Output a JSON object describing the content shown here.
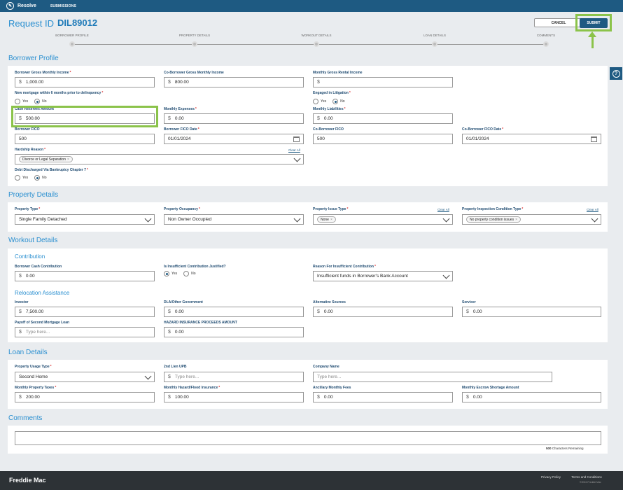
{
  "app": {
    "name": "Resolve",
    "nav_item": "SUBMISSIONS"
  },
  "header": {
    "request_label": "Request ID",
    "request_id": "DIL89012",
    "cancel_label": "CANCEL",
    "submit_label": "SUBMIT"
  },
  "stepper": [
    "BORROWER PROFILE",
    "PROPERTY DETAILS",
    "WORKOUT DETAILS",
    "LOAN DETAILS",
    "COMMENTS"
  ],
  "currency_symbol": "$",
  "required_mark": "*",
  "clear_all": "Clear All",
  "chip_remove": "×",
  "radio": {
    "yes": "Yes",
    "no": "No"
  },
  "borrower": {
    "title": "Borrower Profile",
    "gross_income_label": "Borrower Gross Monthly Income",
    "gross_income": "1,000.00",
    "co_gross_income_label": "Co-Borrower Gross Monthly Income",
    "co_gross_income": "800.00",
    "rental_income_label": "Monthly Gross Rental Income",
    "rental_income": "",
    "new_mortgage_label": "New mortgage within 6 months prior to delinquency",
    "new_mortgage": "No",
    "litigation_label": "Engaged in Litigation",
    "litigation": "No",
    "cash_reserves_label": "Cash Reserves Amount",
    "cash_reserves": "500.00",
    "monthly_expenses_label": "Monthly Expenses",
    "monthly_expenses": "0.00",
    "monthly_liabilities_label": "Monthly Liabilities",
    "monthly_liabilities": "0.00",
    "fico_label": "Borrower FICO",
    "fico": "500",
    "fico_date_label": "Borrower FICO Date",
    "fico_date": "01/01/2024",
    "co_fico_label": "Co-Borrower FICO",
    "co_fico": "500",
    "co_fico_date_label": "Co-Borrower FICO Date",
    "co_fico_date": "01/01/2024",
    "hardship_label": "Hardship Reason",
    "hardship_chip": "Divorce or Legal Separation",
    "bankruptcy_label": "Debt Discharged Via Bankruptcy Chapter 7",
    "bankruptcy": "No"
  },
  "property": {
    "title": "Property Details",
    "type_label": "Property Type",
    "type": "Single Family Detached",
    "occupancy_label": "Property Occupancy",
    "occupancy": "Non Owner Occupied",
    "issue_label": "Property Issue Type",
    "issue_chip": "None",
    "inspection_label": "Property Inspection Condition Type",
    "inspection_chip": "No property condition issues"
  },
  "workout": {
    "title": "Workout Details",
    "contribution_title": "Contribution",
    "cash_contribution_label": "Borrower Cash Contribution",
    "cash_contribution": "0.00",
    "insufficient_label": "Is Insufficient Contribution Justified?",
    "insufficient": "Yes",
    "reason_label": "Reason For Insufficient Contribution",
    "reason": "Insufficient funds in Borrower's Bank Account",
    "relocation_title": "Relocation Assistance",
    "investor_label": "Investor",
    "investor": "7,500.00",
    "dla_label": "DLA/Other Government",
    "dla": "0.00",
    "alt_sources_label": "Alternative Sources",
    "alt_sources": "0.00",
    "servicer_label": "Servicer",
    "servicer": "0.00",
    "payoff_label": "Payoff of Second Mortgage Loan",
    "payoff_placeholder": "Type here...",
    "hazard_proceeds_label": "HAZARD INSURANCE PROCEEDS AMOUNT",
    "hazard_proceeds": "0.00"
  },
  "loan": {
    "title": "Loan Details",
    "usage_label": "Property Usage Type",
    "usage": "Second Home",
    "second_lien_label": "2nd Lien UPB",
    "second_lien_placeholder": "Type here...",
    "company_label": "Company Name",
    "company_placeholder": "Type here...",
    "taxes_label": "Monthly Property Taxes",
    "taxes": "200.00",
    "hazard_label": "Monthly Hazard/Flood Insurance",
    "hazard": "100.00",
    "ancillary_label": "Ancillary Monthly Fees",
    "ancillary": "0.00",
    "escrow_label": "Monthly Escrow Shortage Amount",
    "escrow": "0.00"
  },
  "comments": {
    "title": "Comments",
    "count": "500",
    "remaining_label": "Characters Remaining"
  },
  "footer": {
    "brand": "Freddie Mac",
    "privacy": "Privacy Policy",
    "terms": "Terms and Conditions",
    "copyright": "©2024 Freddie Mac"
  },
  "colors": {
    "primary": "#1e5a82",
    "accent": "#2a8fd0",
    "highlight": "#8bc34a",
    "footer": "#2d3236"
  }
}
